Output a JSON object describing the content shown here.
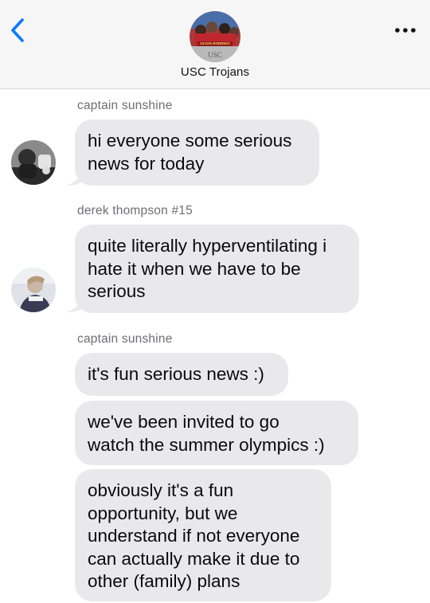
{
  "header": {
    "group_name": "USC Trojans",
    "avatar_banner_text": "OLIVIA RODRIGO",
    "avatar_logo_text": "USC"
  },
  "messages": [
    {
      "sender": "captain sunshine",
      "text": "hi everyone some serious\nnews for today"
    },
    {
      "sender": "derek thompson #15",
      "text": "quite literally hyperventilating i\nhate it when we have to be\nserious"
    },
    {
      "sender": "captain sunshine",
      "text": "it's fun serious news :)"
    },
    {
      "text": "we've been invited to go\nwatch the summer olympics :)"
    },
    {
      "text": "obviously it's a fun\nopportunity, but we\nunderstand if not everyone\ncan actually make it due to\nother (family) plans"
    }
  ],
  "colors": {
    "accent": "#0a7aff",
    "bubble": "#e9e9eb",
    "header_bg": "#f6f6f6",
    "sender_text": "#6e6e73"
  }
}
